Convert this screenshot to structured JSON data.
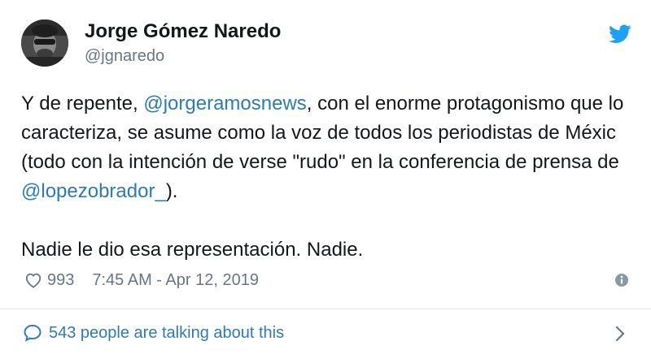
{
  "user": {
    "display_name": "Jorge Gómez Naredo",
    "handle": "@jgnaredo"
  },
  "tweet": {
    "segments": [
      {
        "text": "Y de repente, ",
        "mention": false
      },
      {
        "text": "@jorgeramosnews",
        "mention": true
      },
      {
        "text": ", con el enorme protagonismo que lo caracteriza, se asume como la voz de todos los periodistas de Méxic (todo con la intención de verse \"rudo\" en la conferencia de prensa de ",
        "mention": false
      },
      {
        "text": "@lopezobrador_",
        "mention": true
      },
      {
        "text": ").",
        "mention": false
      }
    ],
    "second_paragraph": "Nadie le dio esa representación. Nadie."
  },
  "meta": {
    "like_count": "993",
    "timestamp": "7:45 AM - Apr 12, 2019"
  },
  "conversation": {
    "label": "543 people are talking about this"
  },
  "icons": {
    "brand": "twitter-bird-icon",
    "like": "heart-icon",
    "info": "info-icon",
    "conversation": "speech-bubble-icon",
    "chevron": "chevron-right-icon"
  },
  "colors": {
    "link": "#2b7bb9",
    "twitter_blue": "#1da1f2",
    "secondary_text": "#657786",
    "primary_text": "#14171a",
    "divider": "#e1e8ed"
  }
}
